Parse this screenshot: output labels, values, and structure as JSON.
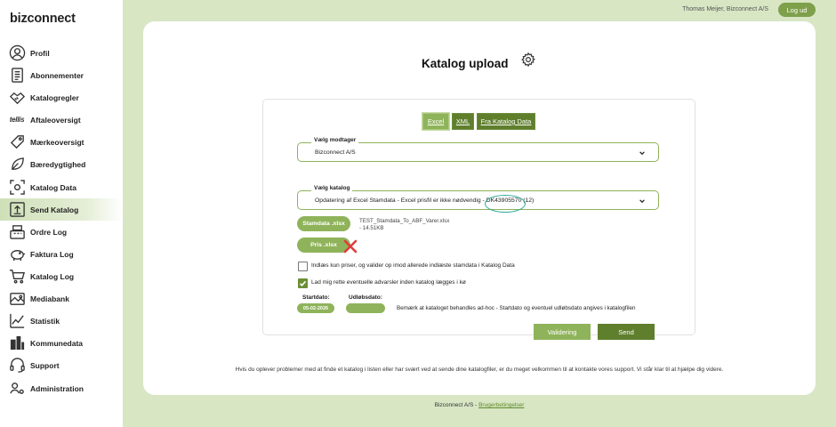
{
  "brand": {
    "logo_text": "bizconnect"
  },
  "sidebar": {
    "items": [
      {
        "label": "Profil",
        "icon": "user-circle-icon"
      },
      {
        "label": "Abonnementer",
        "icon": "document-list-icon"
      },
      {
        "label": "Katalogregler",
        "icon": "handshake-icon"
      },
      {
        "label": "Aftaleoversigt",
        "icon": "tellis-logo",
        "icon_text": "tellis"
      },
      {
        "label": "Mærkeoversigt",
        "icon": "tag-icon"
      },
      {
        "label": "Bæredygtighed",
        "icon": "leaf-icon"
      },
      {
        "label": "Katalog Data",
        "icon": "scan-icon"
      },
      {
        "label": "Send Katalog",
        "icon": "upload-icon",
        "active": true
      },
      {
        "label": "Ordre Log",
        "icon": "cash-register-icon"
      },
      {
        "label": "Faktura Log",
        "icon": "piggy-bank-icon"
      },
      {
        "label": "Katalog Log",
        "icon": "shopping-cart-icon"
      },
      {
        "label": "Mediabank",
        "icon": "image-folder-icon"
      },
      {
        "label": "Statistik",
        "icon": "chart-icon"
      },
      {
        "label": "Kommunedata",
        "icon": "buildings-icon"
      },
      {
        "label": "Support",
        "icon": "headset-icon"
      },
      {
        "label": "Administration",
        "icon": "admin-users-icon"
      }
    ]
  },
  "header": {
    "user_name": "Thomas Meijer, Bizconnect A/S",
    "logout_label": "Log ud"
  },
  "main": {
    "title": "Katalog upload",
    "tabs": [
      {
        "label": "Excel"
      },
      {
        "label": "XML"
      },
      {
        "label": "Fra Katalog Data"
      }
    ],
    "receiver": {
      "legend": "Vælg modtager",
      "value": "Bizconnect A/S"
    },
    "catalog": {
      "legend": "Vælg katalog",
      "value": "Opdatering af Excel Stamdata - Excel prisfil er ikke nødvendig - DK43905570 (12)"
    },
    "stamdata_button": "Stamdata .xlsx",
    "file_name": "TEST_Stamdata_To_ABF_Varer.xlsx",
    "file_size": "- 14.51KB",
    "pris_button": "Pris .xlsx",
    "checkbox1": {
      "label": "Indlæs kun priser, og valider op imod allerede indlæste stamdata i Katalog Data",
      "checked": false
    },
    "checkbox2": {
      "label": "Lad mig rette eventuelle advarsler inden katalog lægges i kø",
      "checked": true
    },
    "start_label": "Startdato:",
    "start_value": "05-02-2026",
    "expiry_label": "Udløbsdato:",
    "expiry_value": "",
    "date_note": "Bemærk at kataloget behandles ad-hoc - Startdato og eventuel udløbsdato angives i katalogfilen",
    "validate_button": "Validering",
    "send_button": "Send",
    "help_text": "Hvis du oplever problemer med at finde et katalog i listen eller har svært ved at sende dine katalogfiler, er du meget velkommen til at kontakte vores support. Vi står klar til at hjælpe dig videre."
  },
  "footer": {
    "company": "Bizconnect A/S",
    "separator": " - ",
    "terms_link": "Brugerbetingelser"
  },
  "colors": {
    "accent": "#8fb35a",
    "accent_dark": "#5f7f2d",
    "background": "#d8e6c4",
    "annotation_circle": "#2aa89a",
    "annotation_x": "#e23b3b"
  }
}
